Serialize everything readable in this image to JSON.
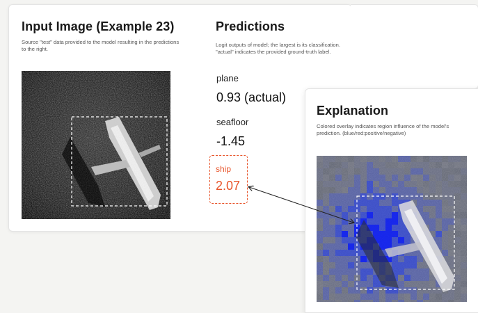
{
  "input": {
    "title": "Input Image (Example 23)",
    "description": "Source \"test\" data provided to the model resulting in the predictions to the right."
  },
  "predictions": {
    "title": "Predictions",
    "description": "Logit outputs of model; the largest is its classification. \"actual\" indicates the provided ground-truth label.",
    "items": [
      {
        "label": "plane",
        "value": "0.93 (actual)"
      },
      {
        "label": "seafloor",
        "value": "-1.45"
      },
      {
        "label": "ship",
        "value": "2.07"
      }
    ]
  },
  "explanation": {
    "title": "Explanation",
    "description": "Colored overlay indicates region influence of the model's prediction. (blue/red:positive/negative)"
  },
  "colors": {
    "highlight": "#e8542a",
    "positive": "#1f3cff",
    "negative": "#ff3030"
  }
}
